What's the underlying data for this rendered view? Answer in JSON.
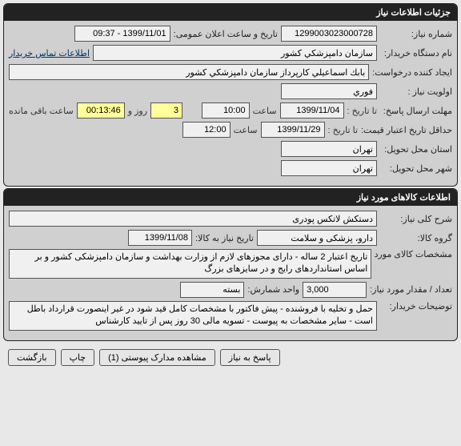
{
  "section1": {
    "title": "جزئیات اطلاعات نیاز",
    "need_no_label": "شماره نیاز:",
    "need_no": "1299003023000728",
    "pub_label": "تاریخ و ساعت اعلان عمومی:",
    "pub_value": "1399/11/01 - 09:37",
    "buyer_org_label": "نام دستگاه خریدار:",
    "buyer_org": "سازمان دامپزشكي كشور",
    "contact_link": "اطلاعات تماس خریدار",
    "creator_label": "ایجاد کننده درخواست:",
    "creator": "بابك اسماعيلي كارپرداز سازمان دامپزشكي كشور",
    "priority_label": "اولویت نیاز :",
    "priority": "فوري",
    "deadline_label": "مهلت ارسال پاسخ:",
    "until_label": "تا تاریخ :",
    "deadline_date": "1399/11/04",
    "time_label": "ساعت",
    "deadline_time": "10:00",
    "days_value": "3",
    "days_unit": "روز و",
    "countdown": "00:13:46",
    "remaining_label": "ساعت باقی مانده",
    "price_validity_label": "حداقل تاریخ اعتبار قیمت:",
    "price_validity_date": "1399/11/29",
    "price_validity_time": "12:00",
    "province_label": "استان محل تحویل:",
    "province": "تهران",
    "city_label": "شهر محل تحویل:",
    "city": "تهران"
  },
  "section2": {
    "title": "اطلاعات کالاهای مورد نیاز",
    "desc_label": "شرح کلی نیاز:",
    "desc": "دستکش لاتکس پودری",
    "group_label": "گروه کالا:",
    "group": "دارو، پزشکی و سلامت",
    "need_date_label": "تاریخ نیاز به کالا:",
    "need_date": "1399/11/08",
    "spec_label": "مشخصات کالای مورد نیاز:",
    "spec": "تاریخ اعتبار 2 ساله - دارای مجوزهای لازم از وزارت بهداشت و سازمان دامپزشکی کشور و بر اساس استانداردهای رایج و در سایزهای بزرگ",
    "qty_label": "تعداد / مقدار مورد نیاز:",
    "qty": "3,000",
    "unit_label": "واحد شمارش:",
    "unit": "بسته",
    "buyer_notes_label": "توضیحات خریدار:",
    "buyer_notes": "حمل و تخلیه با فروشنده - پیش فاکتور با مشخصات کامل قید شود در غیر اینصورت قرارداد باطل است - سایر مشخصات به پیوست - تسویه مالی 30 روز پس از تایید کارشناس"
  },
  "buttons": {
    "reply": "پاسخ به نیاز",
    "attachments": "مشاهده مدارک پیوستی (1)",
    "print": "چاپ",
    "back": "بازگشت"
  }
}
